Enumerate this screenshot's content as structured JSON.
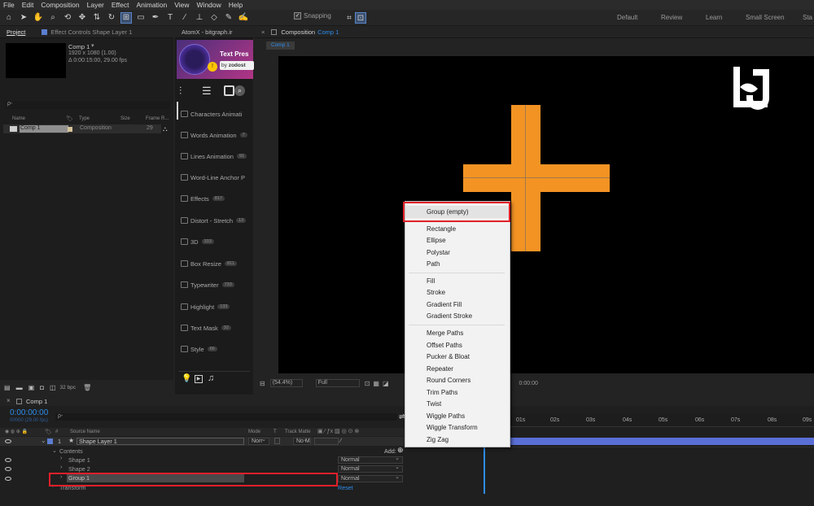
{
  "menubar": {
    "items": [
      "File",
      "Edit",
      "Composition",
      "Layer",
      "Effect",
      "Animation",
      "View",
      "Window",
      "Help"
    ]
  },
  "toolbar": {
    "snapping_label": "Snapping",
    "workspaces": [
      "Default",
      "Review",
      "Learn",
      "Small Screen",
      "Sta"
    ]
  },
  "project_panel": {
    "tab_label": "Project",
    "effect_controls_label": "Effect Controls Shape Layer 1",
    "comp_name": "Comp 1",
    "comp_info_1": "1920 x 1080 (1.00)",
    "comp_info_2": "Δ 0:00:15:00, 29.00 fps",
    "search_placeholder": "ρ-",
    "columns": {
      "name": "Name",
      "type": "Type",
      "size": "Size",
      "frame_rate": "Frame R..."
    },
    "row": {
      "name": "Comp 1",
      "type": "Composition",
      "frame_rate": "29"
    },
    "bpc": "32 bpc"
  },
  "atomx_panel": {
    "tab_label": "AtomX - bitgraph.ir",
    "banner_title": "Text Pres",
    "banner_by": "by",
    "banner_author": "zodost",
    "items": [
      {
        "label": "Characters Animati",
        "badge": ""
      },
      {
        "label": "Words Animation",
        "badge": "7"
      },
      {
        "label": "Lines Animation",
        "badge": "91"
      },
      {
        "label": "Word-Line Anchor P",
        "badge": ""
      },
      {
        "label": "Effects",
        "badge": "817"
      },
      {
        "label": "Distort - Stretch",
        "badge": "13"
      },
      {
        "label": "3D",
        "badge": "333"
      },
      {
        "label": "Box Resize",
        "badge": "811"
      },
      {
        "label": "Typewriter",
        "badge": "733"
      },
      {
        "label": "Highlight",
        "badge": "133"
      },
      {
        "label": "Text Mask",
        "badge": "32"
      },
      {
        "label": "Style",
        "badge": "66"
      }
    ]
  },
  "composition_panel": {
    "tab_prefix": "Composition",
    "tab_comp": "Comp 1",
    "sub_tab": "Comp 1",
    "zoom": "(54.4%)",
    "resolution": "Full",
    "timecode": "0:00:00"
  },
  "context_menu": {
    "items": [
      "Group (empty)",
      "Rectangle",
      "Ellipse",
      "Polystar",
      "Path",
      "Fill",
      "Stroke",
      "Gradient Fill",
      "Gradient Stroke",
      "Merge Paths",
      "Offset Paths",
      "Pucker & Bloat",
      "Repeater",
      "Round Corners",
      "Trim Paths",
      "Twist",
      "Wiggle Paths",
      "Wiggle Transform",
      "Zig Zag"
    ]
  },
  "timeline": {
    "tab_label": "Comp 1",
    "timecode": "0:00:00:00",
    "timecode_sub": "00000 (29.00 fps)",
    "search_placeholder": "ρ-",
    "columns": {
      "source_name": "Source Name",
      "mode": "Mode",
      "t": "T",
      "track_matte": "Track Matte"
    },
    "ruler": [
      "01s",
      "02s",
      "03s",
      "04s",
      "05s",
      "06s",
      "07s",
      "08s",
      "09s"
    ],
    "layer": {
      "number": "1",
      "name": "Shape Layer 1",
      "mode": "Norr",
      "matte": "No M"
    },
    "contents_label": "Contents",
    "add_label": "Add:",
    "rows": [
      {
        "name": "Shape 1",
        "mode": "Normal"
      },
      {
        "name": "Shape 2",
        "mode": "Normal"
      },
      {
        "name": "Group 1",
        "mode": "Normal"
      }
    ],
    "transform_label": "Transform",
    "reset_label": "Reset"
  },
  "colors": {
    "orange": "#f39324",
    "highlight_red": "#e0202a",
    "accent_blue": "#2d8ceb",
    "timeline_bar": "#5a6fd6"
  }
}
